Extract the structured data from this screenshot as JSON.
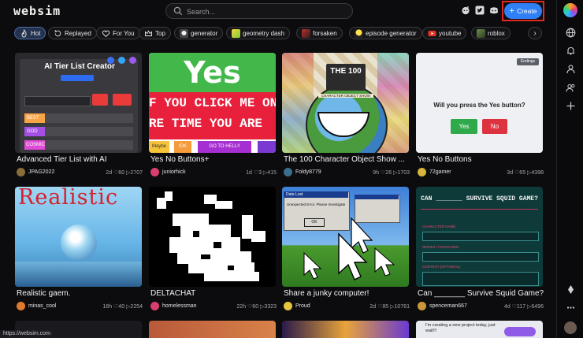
{
  "app": {
    "logo": "websim"
  },
  "search": {
    "placeholder": "Search..."
  },
  "header": {
    "create_label": "Create"
  },
  "chips": [
    {
      "label": "Hot",
      "icon": "flame-icon"
    },
    {
      "label": "Replayed",
      "icon": "replay-icon"
    },
    {
      "label": "For You",
      "icon": "heart-icon"
    },
    {
      "label": "Top",
      "icon": "crown-icon"
    },
    {
      "label": "generator",
      "icon": "skull-thumb"
    },
    {
      "label": "geometry dash",
      "icon": "geometry-dash-thumb"
    },
    {
      "label": "forsaken",
      "icon": "forsaken-thumb"
    },
    {
      "label": "episode generator",
      "icon": "lightbulb-thumb"
    },
    {
      "label": "youtube",
      "icon": "youtube-icon"
    },
    {
      "label": "roblox",
      "icon": "roblox-thumb"
    }
  ],
  "cards": [
    {
      "title": "Advanced Tier List with AI",
      "user": "JPAG2022",
      "stats": "2d ♡60 ▷2707",
      "thumb_text": "AI Tier List Creator",
      "thumb_sub": [
        "BEST",
        "GOD",
        "COSMIC"
      ]
    },
    {
      "title": "Yes No Buttons+",
      "user": "juniorhick",
      "stats": "1d ♡3 ▷415",
      "thumb_text": "Yes",
      "thumb_sub": [
        "F YOU CLICK ME ON",
        "RE TIME YOU ARE",
        "Maybe",
        "IDK",
        "GO TO HELL!!"
      ]
    },
    {
      "title": "The 100 Character Object Show ...",
      "user": "Foldy8779",
      "stats": "9h ♡26 ▷1703",
      "thumb_text": "THE 100",
      "thumb_sub": [
        "CHARACTER OBJECT SHOW"
      ]
    },
    {
      "title": "Yes No Buttons",
      "user": "72gamer",
      "stats": "3d ♡65 ▷4398",
      "thumb_text": "Will you press the Yes button?",
      "thumb_sub": [
        "Yes",
        "No",
        "Endings"
      ]
    },
    {
      "title": "Realistic gaem.",
      "user": "minas_cool",
      "stats": "18h ♡40 ▷2254",
      "thumb_text": "Realistic",
      "thumb_sub": []
    },
    {
      "title": "DELTACHAT",
      "user": "homelessman",
      "stats": "22h ♡60 ▷3323",
      "thumb_text": "",
      "thumb_sub": []
    },
    {
      "title": "Share a junky computer!",
      "user": "Proud",
      "stats": "2d ♡85 ▷10761",
      "thumb_text": "Data Lost",
      "thumb_sub": [
        "Unexpected Error. Please Investigate",
        "OK"
      ]
    },
    {
      "title": "Can _______ Survive Squid Game?",
      "user": "spenceman667",
      "stats": "4d ♡117 ▷6496",
      "thumb_text": "CAN _______ SURVIVE SQUID GAME?",
      "thumb_sub": [
        "CHARACTER NAME",
        "SERIES / FRANCHISE",
        "CONTEXT (OPTIONAL)"
      ]
    }
  ],
  "bottom_peek": {
    "text": "I'm creating a new project today, just wait!!!"
  },
  "status_url": "https://websim.com",
  "colors": {
    "accent": "#2f7ff5",
    "highlight": "#e0281f",
    "background": "#0c0c0e"
  }
}
